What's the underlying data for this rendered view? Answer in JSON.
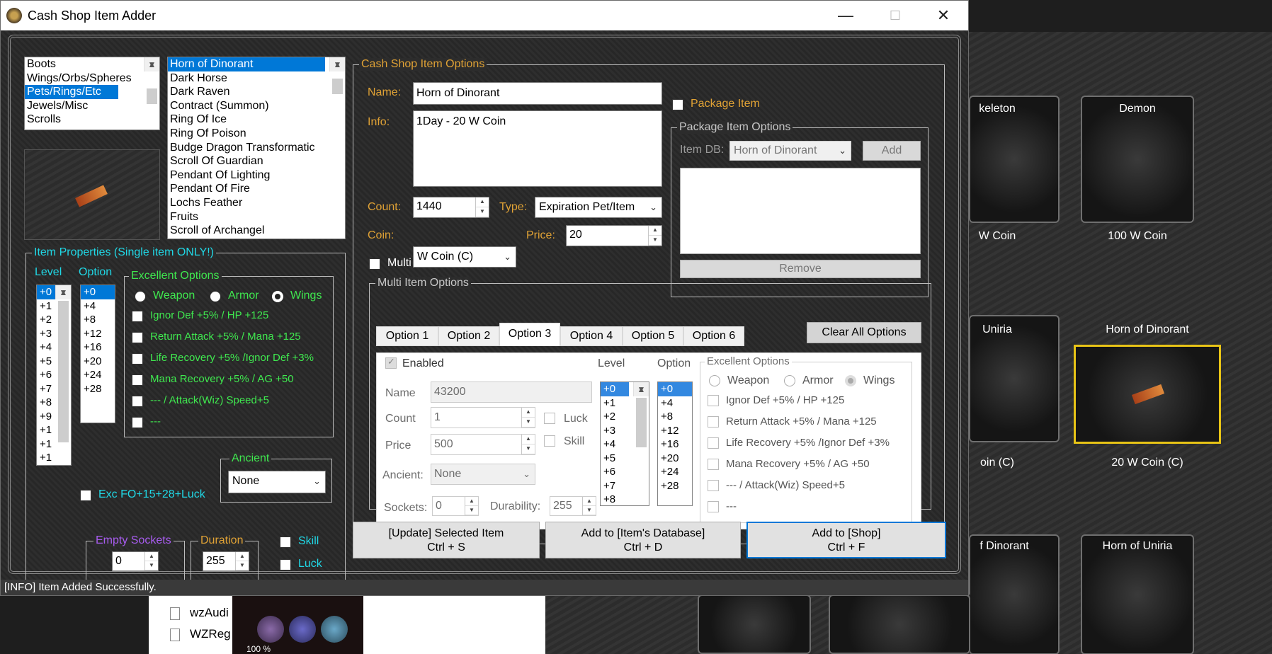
{
  "window": {
    "title": "Cash Shop Item Adder"
  },
  "status": "[INFO] Item Added Successfully.",
  "categories": {
    "items": [
      "Boots",
      "Wings/Orbs/Spheres",
      "Pets/Rings/Etc",
      "Jewels/Misc",
      "Scrolls"
    ],
    "selected": 2
  },
  "items": {
    "list": [
      "Horn of Dinorant",
      "Dark Horse",
      "Dark Raven",
      "Contract (Summon)",
      "Ring Of Ice",
      "Ring Of Poison",
      "Budge Dragon Transformatic",
      "Scroll Of Guardian",
      "Pendant Of Lighting",
      "Pendant Of Fire",
      "Lochs Feather",
      "Fruits",
      "Scroll of Archangel"
    ],
    "selected": 0
  },
  "item_properties": {
    "title": "Item Properties (Single item ONLY!)",
    "level_label": "Level",
    "option_label": "Option",
    "levels": [
      "+0",
      "+1",
      "+2",
      "+3",
      "+4",
      "+5",
      "+6",
      "+7",
      "+8",
      "+9",
      "+1",
      "+1",
      "+1",
      "+1",
      "+1"
    ],
    "options": [
      "+0",
      "+4",
      "+8",
      "+12",
      "+16",
      "+20",
      "+24",
      "+28"
    ],
    "excellent_title": "Excellent Options",
    "weapon": "Weapon",
    "armor": "Armor",
    "wings": "Wings",
    "exc": [
      "Ignor Def +5% / HP +125",
      "Return Attack +5% / Mana +125",
      "Life Recovery +5% /Ignor Def +3%",
      "Mana Recovery +5% / AG +50",
      "--- / Attack(Wiz) Speed+5",
      "---"
    ],
    "exc_fo": "Exc FO+15+28+Luck",
    "ancient_title": "Ancient",
    "ancient_value": "None",
    "sockets_title": "Empty Sockets",
    "sockets_value": "0",
    "duration_title": "Duration",
    "duration_value": "255",
    "skill": "Skill",
    "luck": "Luck"
  },
  "options": {
    "title": "Cash Shop Item Options",
    "name_label": "Name:",
    "name_value": "Horn of Dinorant",
    "info_label": "Info:",
    "info_value": "1Day - 20 W Coin",
    "count_label": "Count:",
    "count_value": "1440",
    "type_label": "Type:",
    "type_value": "Expiration Pet/Item",
    "coin_label": "Coin:",
    "coin_value": "W Coin (C)",
    "price_label": "Price:",
    "price_value": "20",
    "package_item": "Package Item",
    "package_title": "Package Item Options",
    "item_db_label": "Item DB:",
    "item_db_value": "Horn of Dinorant",
    "add": "Add",
    "remove": "Remove",
    "multi_item": "Multi Item"
  },
  "multi": {
    "title": "Multi Item Options",
    "tabs": [
      "Option 1",
      "Option 2",
      "Option 3",
      "Option 4",
      "Option 5",
      "Option 6"
    ],
    "active_tab": 2,
    "clear_all": "Clear All Options",
    "enabled": "Enabled",
    "name_label": "Name",
    "name_value": "43200",
    "count_label": "Count",
    "count_value": "1",
    "price_label": "Price",
    "price_value": "500",
    "ancient_label": "Ancient:",
    "ancient_value": "None",
    "sockets_label": "Sockets:",
    "sockets_value": "0",
    "durability_label": "Durability:",
    "durability_value": "255",
    "luck": "Luck",
    "skill": "Skill",
    "level_label": "Level",
    "option_label": "Option",
    "levels": [
      "+0",
      "+1",
      "+2",
      "+3",
      "+4",
      "+5",
      "+6",
      "+7",
      "+8"
    ],
    "options": [
      "+0",
      "+4",
      "+8",
      "+12",
      "+16",
      "+20",
      "+24",
      "+28"
    ],
    "excellent_title": "Excellent Options",
    "weapon": "Weapon",
    "armor": "Armor",
    "wings": "Wings",
    "exc": [
      "Ignor Def +5% / HP +125",
      "Return Attack +5% / Mana +125",
      "Life Recovery +5% /Ignor Def +3%",
      "Mana Recovery +5% / AG +50",
      "--- / Attack(Wiz) Speed+5",
      "---"
    ]
  },
  "actions": {
    "update": "[Update] Selected Item",
    "update_key": "Ctrl + S",
    "add_db": "Add to [Item's Database]",
    "add_db_key": "Ctrl + D",
    "add_shop": "Add to [Shop]",
    "add_shop_key": "Ctrl + F"
  },
  "background": {
    "shop_labels": [
      "keleton",
      "Demon",
      "W Coin",
      "100 W Coin",
      "Uniria",
      "Horn of Dinorant",
      "oin (C)",
      "20 W Coin (C)",
      "f Dinorant",
      "Horn of Uniria"
    ],
    "explorer_files": [
      "wzAudi",
      "WZReg"
    ],
    "hud_percent": "100 %"
  },
  "colors": {
    "accent": "#0078d7",
    "gold": "#e0a235",
    "green": "#3fe84f",
    "cyan": "#20d8e6",
    "selected_slot": "#e8c416"
  }
}
